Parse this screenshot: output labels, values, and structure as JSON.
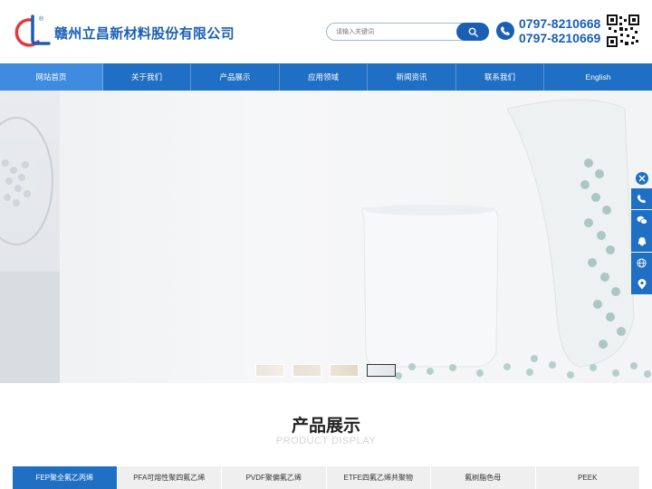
{
  "header": {
    "company_name": "赣州立昌新材料股份有限公司",
    "search_placeholder": "请输入关键词",
    "phone_1": "0797-8210668",
    "phone_2": "0797-8210669"
  },
  "nav": {
    "items": [
      {
        "label": "网站首页",
        "active": true
      },
      {
        "label": "关于我们"
      },
      {
        "label": "产品展示"
      },
      {
        "label": "应用领域"
      },
      {
        "label": "新闻资讯"
      },
      {
        "label": "联系我们"
      },
      {
        "label": "English"
      }
    ]
  },
  "side_tools": [
    "close-icon",
    "phone-icon",
    "wechat-icon",
    "qq-icon",
    "globe-icon",
    "location-icon"
  ],
  "banner": {
    "slide_count": 4,
    "active_slide": 4
  },
  "products": {
    "title": "产品展示",
    "subtitle": "PRODUCT DISPLAY",
    "tabs": [
      {
        "label": "FEP聚全氟乙丙烯",
        "active": true
      },
      {
        "label": "PFA可熔性聚四氟乙烯"
      },
      {
        "label": "PVDF聚偏氟乙烯"
      },
      {
        "label": "ETFE四氟乙烯共聚物"
      },
      {
        "label": "氟树脂色母"
      },
      {
        "label": "PEEK"
      }
    ]
  },
  "colors": {
    "brand_blue": "#1f6fc5",
    "nav_active": "#3f8be0",
    "logo_red": "#e03a3a"
  }
}
